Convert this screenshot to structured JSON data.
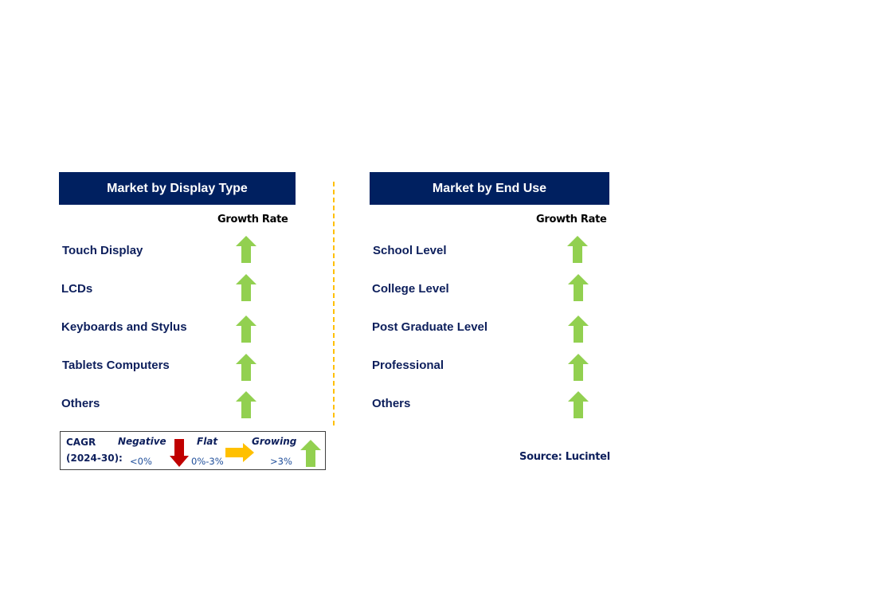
{
  "left_panel": {
    "title": "Market by Display Type",
    "growth_rate_label": "Growth Rate",
    "rows": [
      {
        "label": "Touch Display",
        "trend": "growing"
      },
      {
        "label": "LCDs",
        "trend": "growing"
      },
      {
        "label": "Keyboards and Stylus",
        "trend": "growing"
      },
      {
        "label": "Tablets Computers",
        "trend": "growing"
      },
      {
        "label": "Others",
        "trend": "growing"
      }
    ]
  },
  "right_panel": {
    "title": "Market by End Use",
    "growth_rate_label": "Growth Rate",
    "rows": [
      {
        "label": "School Level",
        "trend": "growing"
      },
      {
        "label": "College Level",
        "trend": "growing"
      },
      {
        "label": "Post Graduate Level",
        "trend": "growing"
      },
      {
        "label": "Professional",
        "trend": "growing"
      },
      {
        "label": "Others",
        "trend": "growing"
      }
    ]
  },
  "legend": {
    "cagr_label": "CAGR",
    "period_label": "(2024-30):",
    "negative": {
      "title": "Negative",
      "range": "<0%",
      "icon": "down-arrow-icon",
      "color": "#c00000"
    },
    "flat": {
      "title": "Flat",
      "range": "0%-3%",
      "icon": "right-arrow-icon",
      "color": "#ffc000"
    },
    "growing": {
      "title": "Growing",
      "range": ">3%",
      "icon": "up-arrow-icon",
      "color": "#92d050"
    }
  },
  "source": "Source: Lucintel",
  "colors": {
    "header_bg": "#002060",
    "label_text": "#0d1f5c",
    "divider": "#ffc000",
    "growing_arrow": "#92d050"
  }
}
